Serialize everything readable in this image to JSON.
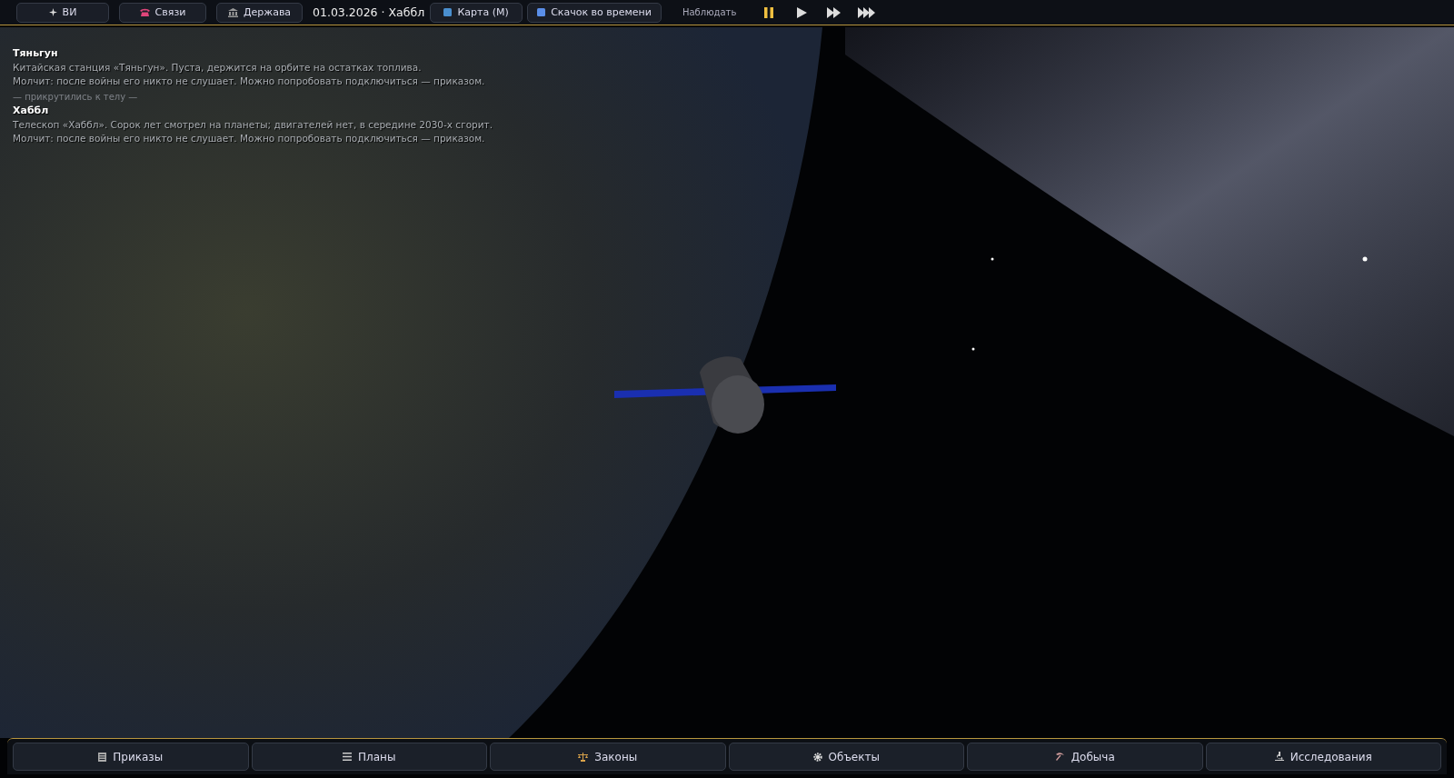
{
  "top_bar": {
    "items": [
      {
        "kind": "button",
        "label": "ВИ"
      },
      {
        "kind": "button",
        "label": "Связи"
      },
      {
        "kind": "button",
        "label": "Держава"
      },
      {
        "kind": "text",
        "label": "01.03.2026 · Хаббл"
      },
      {
        "kind": "button",
        "label": "Карта (M)"
      },
      {
        "kind": "button",
        "label": "Скачок во времени"
      },
      {
        "kind": "label",
        "label": "Наблюдать"
      }
    ],
    "speed_controls": [
      {
        "kind": "pause",
        "selected": true
      },
      {
        "kind": "play",
        "selected": false
      },
      {
        "kind": "fast",
        "selected": false
      },
      {
        "kind": "fastest",
        "selected": false
      }
    ]
  },
  "info_panel": [
    {
      "kind": "object",
      "title": "Тяньгун",
      "lines": [
        "Китайская станция «Тяньгун». Пуста, держится на орбите на остатках топлива.",
        "Молчит: после войны его никто не слушает. Можно попробовать подключиться — приказом."
      ]
    },
    {
      "kind": "note",
      "text": "— прикрутились к телу —"
    },
    {
      "kind": "object",
      "title": "Хаббл",
      "lines": [
        "Телескоп «Хаббл». Сорок лет смотрел на планеты; двигателей нет, в середине 2030-х сгорит.",
        "Молчит: после войны его никто не слушает. Можно попробовать подключиться — приказом."
      ]
    }
  ],
  "bottom_tabs": [
    {
      "label": "Приказы"
    },
    {
      "label": "Планы"
    },
    {
      "label": "Законы"
    },
    {
      "label": "Объекты"
    },
    {
      "label": "Добыча"
    },
    {
      "label": "Исследования"
    }
  ]
}
